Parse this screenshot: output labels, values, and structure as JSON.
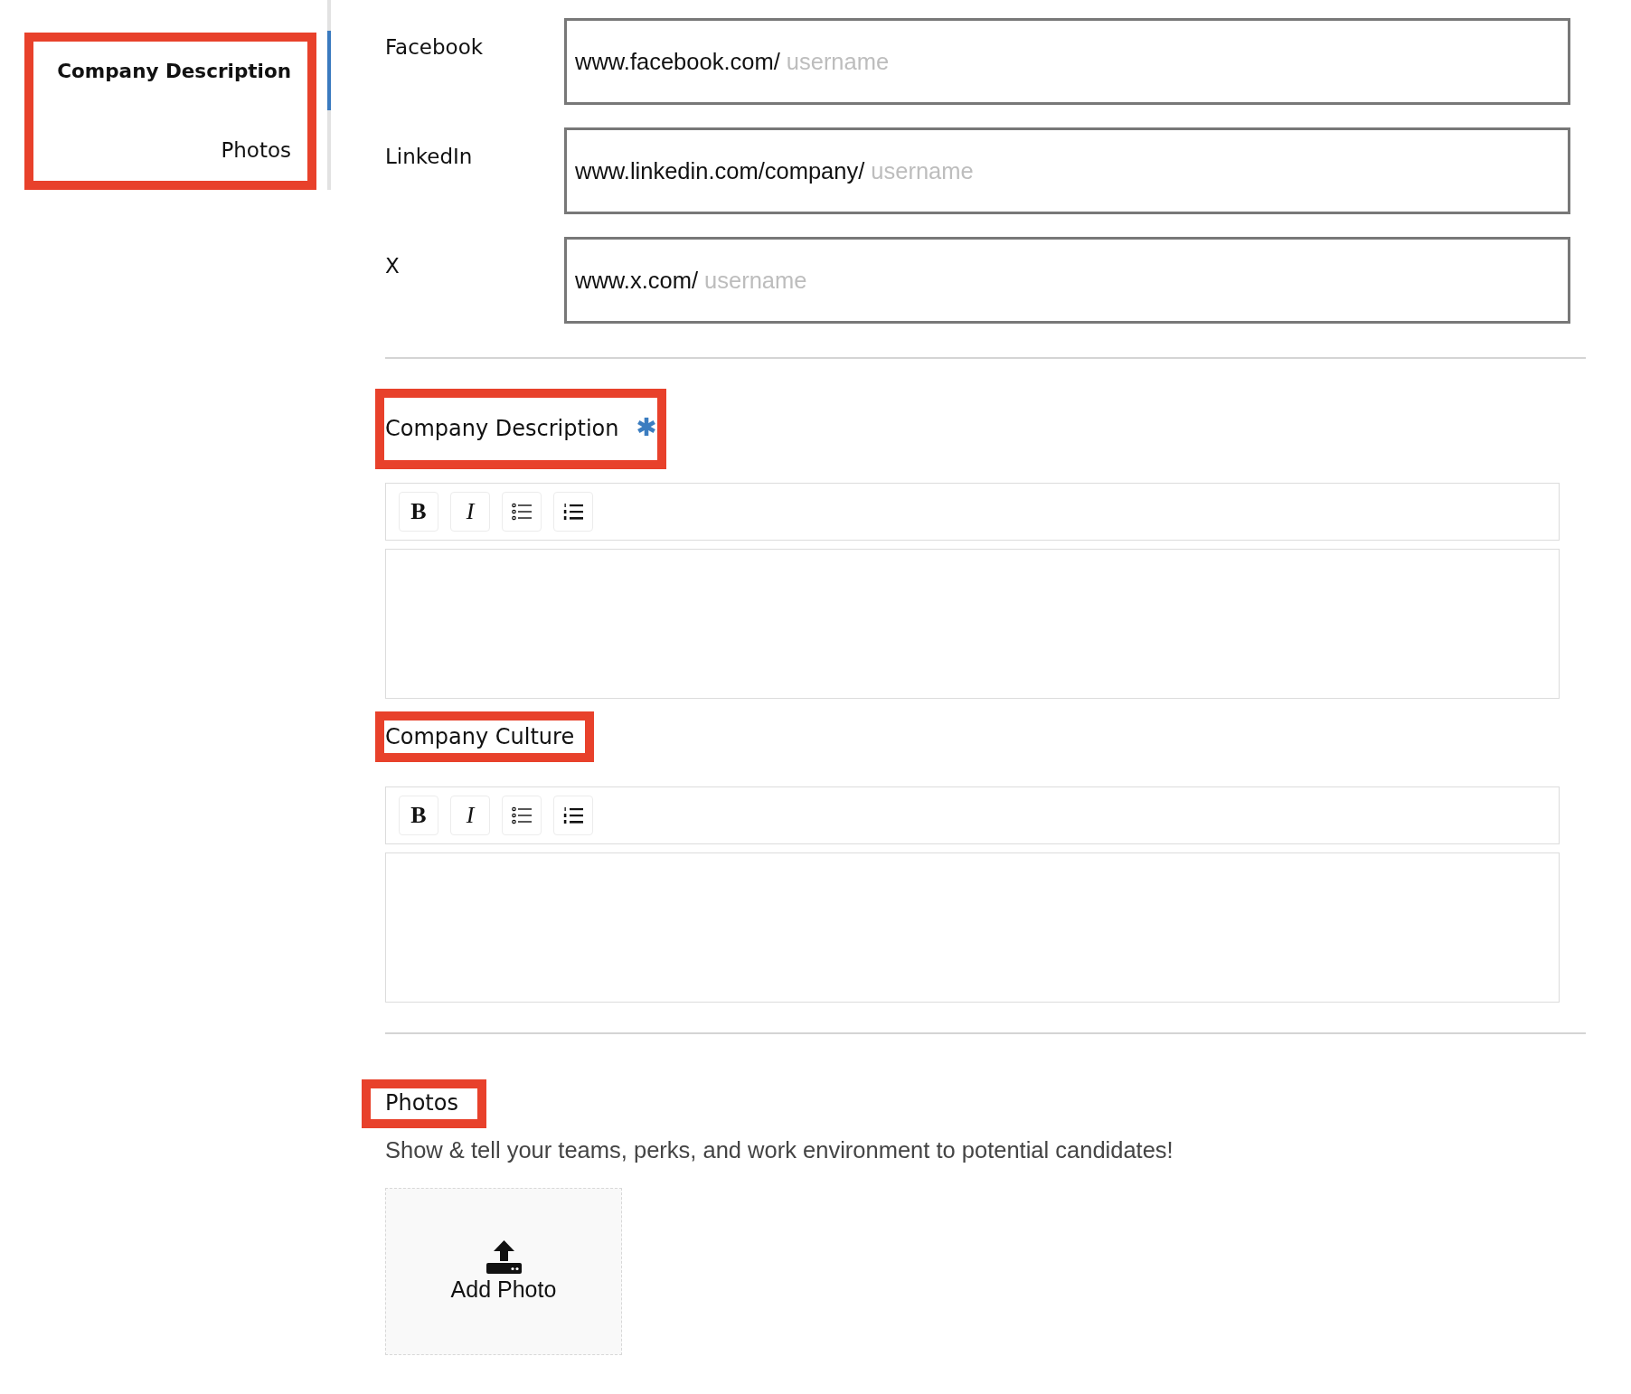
{
  "sidebar": {
    "highlighted": true,
    "items": [
      {
        "label": "Company Description",
        "selected": true
      },
      {
        "label": "Photos",
        "selected": false
      }
    ]
  },
  "social_links": [
    {
      "label": "Facebook",
      "prefix": "www.facebook.com/",
      "placeholder": "username"
    },
    {
      "label": "LinkedIn",
      "prefix": "www.linkedin.com/company/",
      "placeholder": "username"
    },
    {
      "label": "X",
      "prefix": "www.x.com/",
      "placeholder": "username"
    }
  ],
  "editors": [
    {
      "title": "Company Description",
      "required": true,
      "highlighted": true,
      "toolbar": [
        {
          "kind": "bold",
          "label": "B"
        },
        {
          "kind": "italic",
          "label": "I"
        },
        {
          "kind": "bullet-list"
        },
        {
          "kind": "numbered-list"
        }
      ]
    },
    {
      "title": "Company Culture",
      "required": false,
      "highlighted": true,
      "toolbar": [
        {
          "kind": "bold",
          "label": "B"
        },
        {
          "kind": "italic",
          "label": "I"
        },
        {
          "kind": "bullet-list"
        },
        {
          "kind": "numbered-list"
        }
      ]
    }
  ],
  "photos": {
    "title": "Photos",
    "highlighted": true,
    "description": "Show & tell your teams, perks, and work environment to potential candidates!",
    "add_button": "Add Photo"
  }
}
